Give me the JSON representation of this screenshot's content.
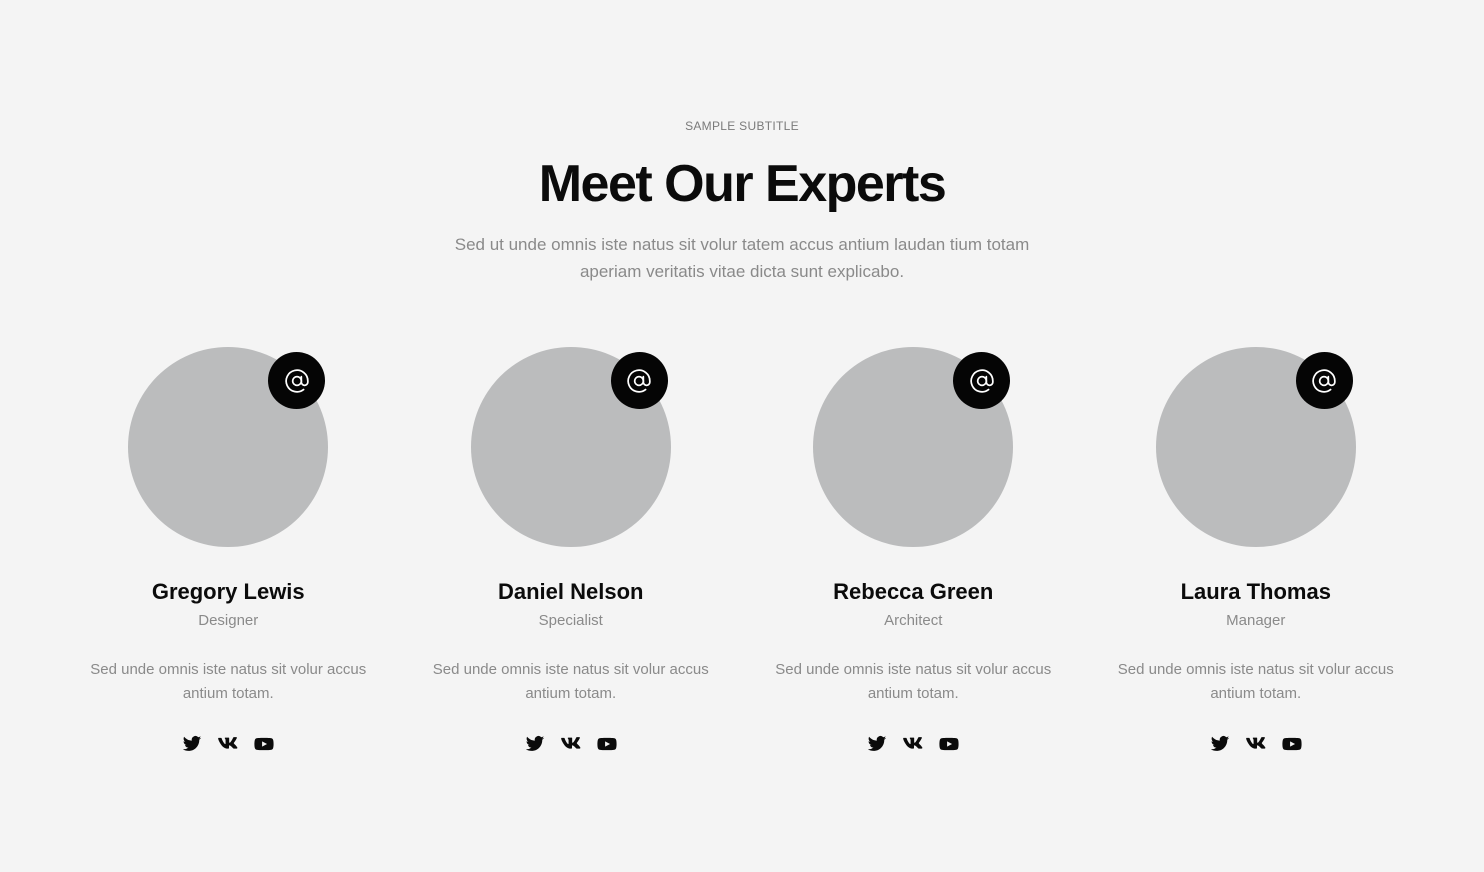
{
  "header": {
    "subtitle": "SAMPLE SUBTITLE",
    "title": "Meet Our Experts",
    "intro": "Sed ut unde omnis iste natus sit volur tatem accus antium laudan tium totam aperiam veritatis vitae dicta sunt explicabo."
  },
  "colors": {
    "background": "#f4f4f4",
    "avatar_placeholder": "#bbbcbd",
    "badge": "#050505",
    "muted_text": "#8a8a8a"
  },
  "members": [
    {
      "name": "Gregory Lewis",
      "role": "Designer",
      "bio": "Sed unde omnis iste natus sit volur accus antium totam.",
      "badge_icon": "at-sign-icon",
      "socials": [
        "twitter-icon",
        "vk-icon",
        "youtube-icon"
      ]
    },
    {
      "name": "Daniel Nelson",
      "role": "Specialist",
      "bio": "Sed unde omnis iste natus sit volur accus antium totam.",
      "badge_icon": "at-sign-icon",
      "socials": [
        "twitter-icon",
        "vk-icon",
        "youtube-icon"
      ]
    },
    {
      "name": "Rebecca Green",
      "role": "Architect",
      "bio": "Sed unde omnis iste natus sit volur accus antium totam.",
      "badge_icon": "at-sign-icon",
      "socials": [
        "twitter-icon",
        "vk-icon",
        "youtube-icon"
      ]
    },
    {
      "name": "Laura Thomas",
      "role": "Manager",
      "bio": "Sed unde omnis iste natus sit volur accus antium totam.",
      "badge_icon": "at-sign-icon",
      "socials": [
        "twitter-icon",
        "vk-icon",
        "youtube-icon"
      ]
    }
  ]
}
